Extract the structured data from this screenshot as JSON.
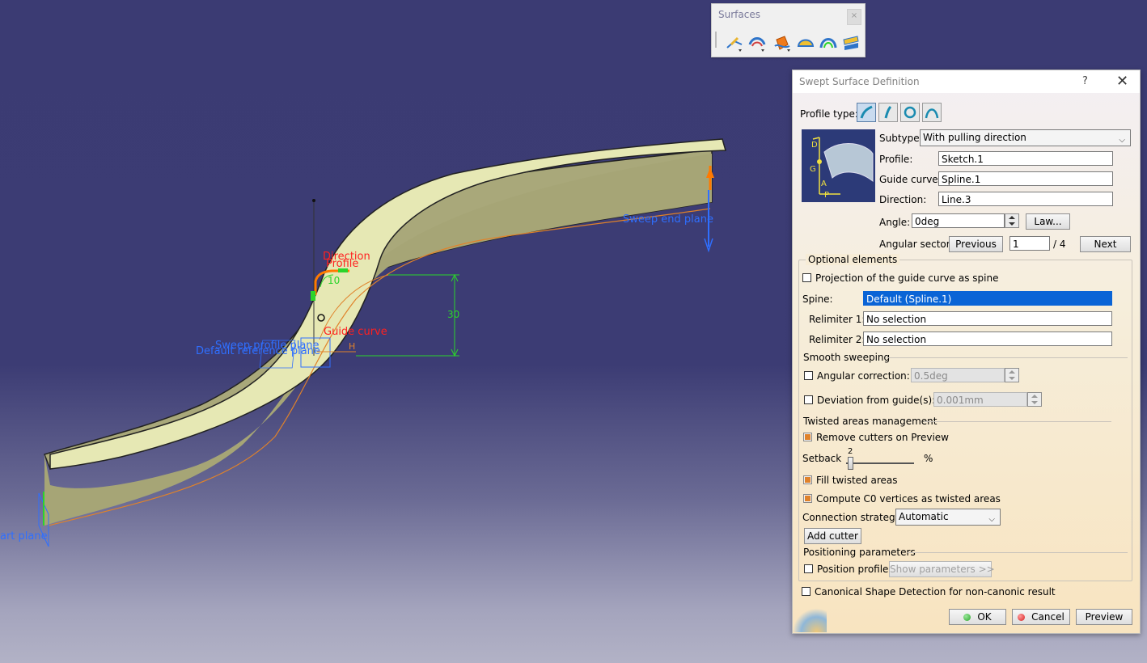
{
  "viewport": {
    "labels": {
      "direction": "Direction",
      "profile": "Profile",
      "guide_curve": "Guide curve",
      "sweep_profile_plane": "Sweep profile plane",
      "default_reference_plane": "Default reference plane",
      "sweep_end_plane": "Sweep end plane",
      "start_plane": "art plane",
      "dim_angle": "10",
      "dim_height": "30",
      "h_label": "H"
    }
  },
  "toolbar": {
    "title": "Surfaces",
    "icons": [
      "extrude-icon",
      "offset-icon",
      "sweep-icon",
      "fill-icon",
      "multi-section-icon",
      "blend-icon"
    ]
  },
  "dialog": {
    "title": "Swept Surface Definition",
    "help": "?",
    "close": "✕",
    "profile_type_label": "Profile type:",
    "profile_types": [
      "explicit",
      "line",
      "circle",
      "conic"
    ],
    "preview_letters": {
      "d": "D",
      "g": "G",
      "p": "P",
      "a": "A"
    },
    "subtype_label": "Subtype:",
    "subtype_value": "With pulling direction",
    "profile_label": "Profile:",
    "profile_value": "Sketch.1",
    "guide_label": "Guide curve:",
    "guide_value": "Spline.1",
    "direction_label": "Direction:",
    "direction_value": "Line.3",
    "angle_label": "Angle:",
    "angle_value": "0deg",
    "law_button": "Law...",
    "angular_sector_label": "Angular sector:",
    "previous_button": "Previous",
    "sector_value": "1",
    "sector_total": "/ 4",
    "next_button": "Next",
    "optional_elements": "Optional elements",
    "projection_label": "Projection of the guide curve as spine",
    "spine_label": "Spine:",
    "spine_value": "Default (Spline.1)",
    "relimiter1_label": "Relimiter 1:",
    "relimiter1_value": "No selection",
    "relimiter2_label": "Relimiter 2:",
    "relimiter2_value": "No selection",
    "smooth_sweeping": "Smooth sweeping",
    "angular_correction_label": "Angular correction:",
    "angular_correction_value": "0.5deg",
    "deviation_label": "Deviation from guide(s):",
    "deviation_value": "0.001mm",
    "twisted_areas": "Twisted areas management",
    "remove_cutters_label": "Remove cutters on Preview",
    "setback_label": "Setback",
    "setback_value": "2",
    "setback_fraction": 0.06,
    "setback_unit": "%",
    "fill_twisted_label": "Fill twisted areas",
    "compute_c0_label": "Compute C0 vertices as twisted areas",
    "connection_label": "Connection strategy:",
    "connection_value": "Automatic",
    "add_cutter_button": "Add cutter",
    "positioning_parameters": "Positioning parameters",
    "position_profile_label": "Position profile",
    "show_parameters_button": "Show parameters >>",
    "canonical_label": "Canonical Shape Detection for non-canonic result",
    "ok_button": "OK",
    "cancel_button": "Cancel",
    "preview_button": "Preview",
    "colors": {
      "accent": "#e0822a",
      "selection": "#0a64d6",
      "ok_green": "#2aa52a",
      "cancel_red": "#d62020"
    }
  }
}
